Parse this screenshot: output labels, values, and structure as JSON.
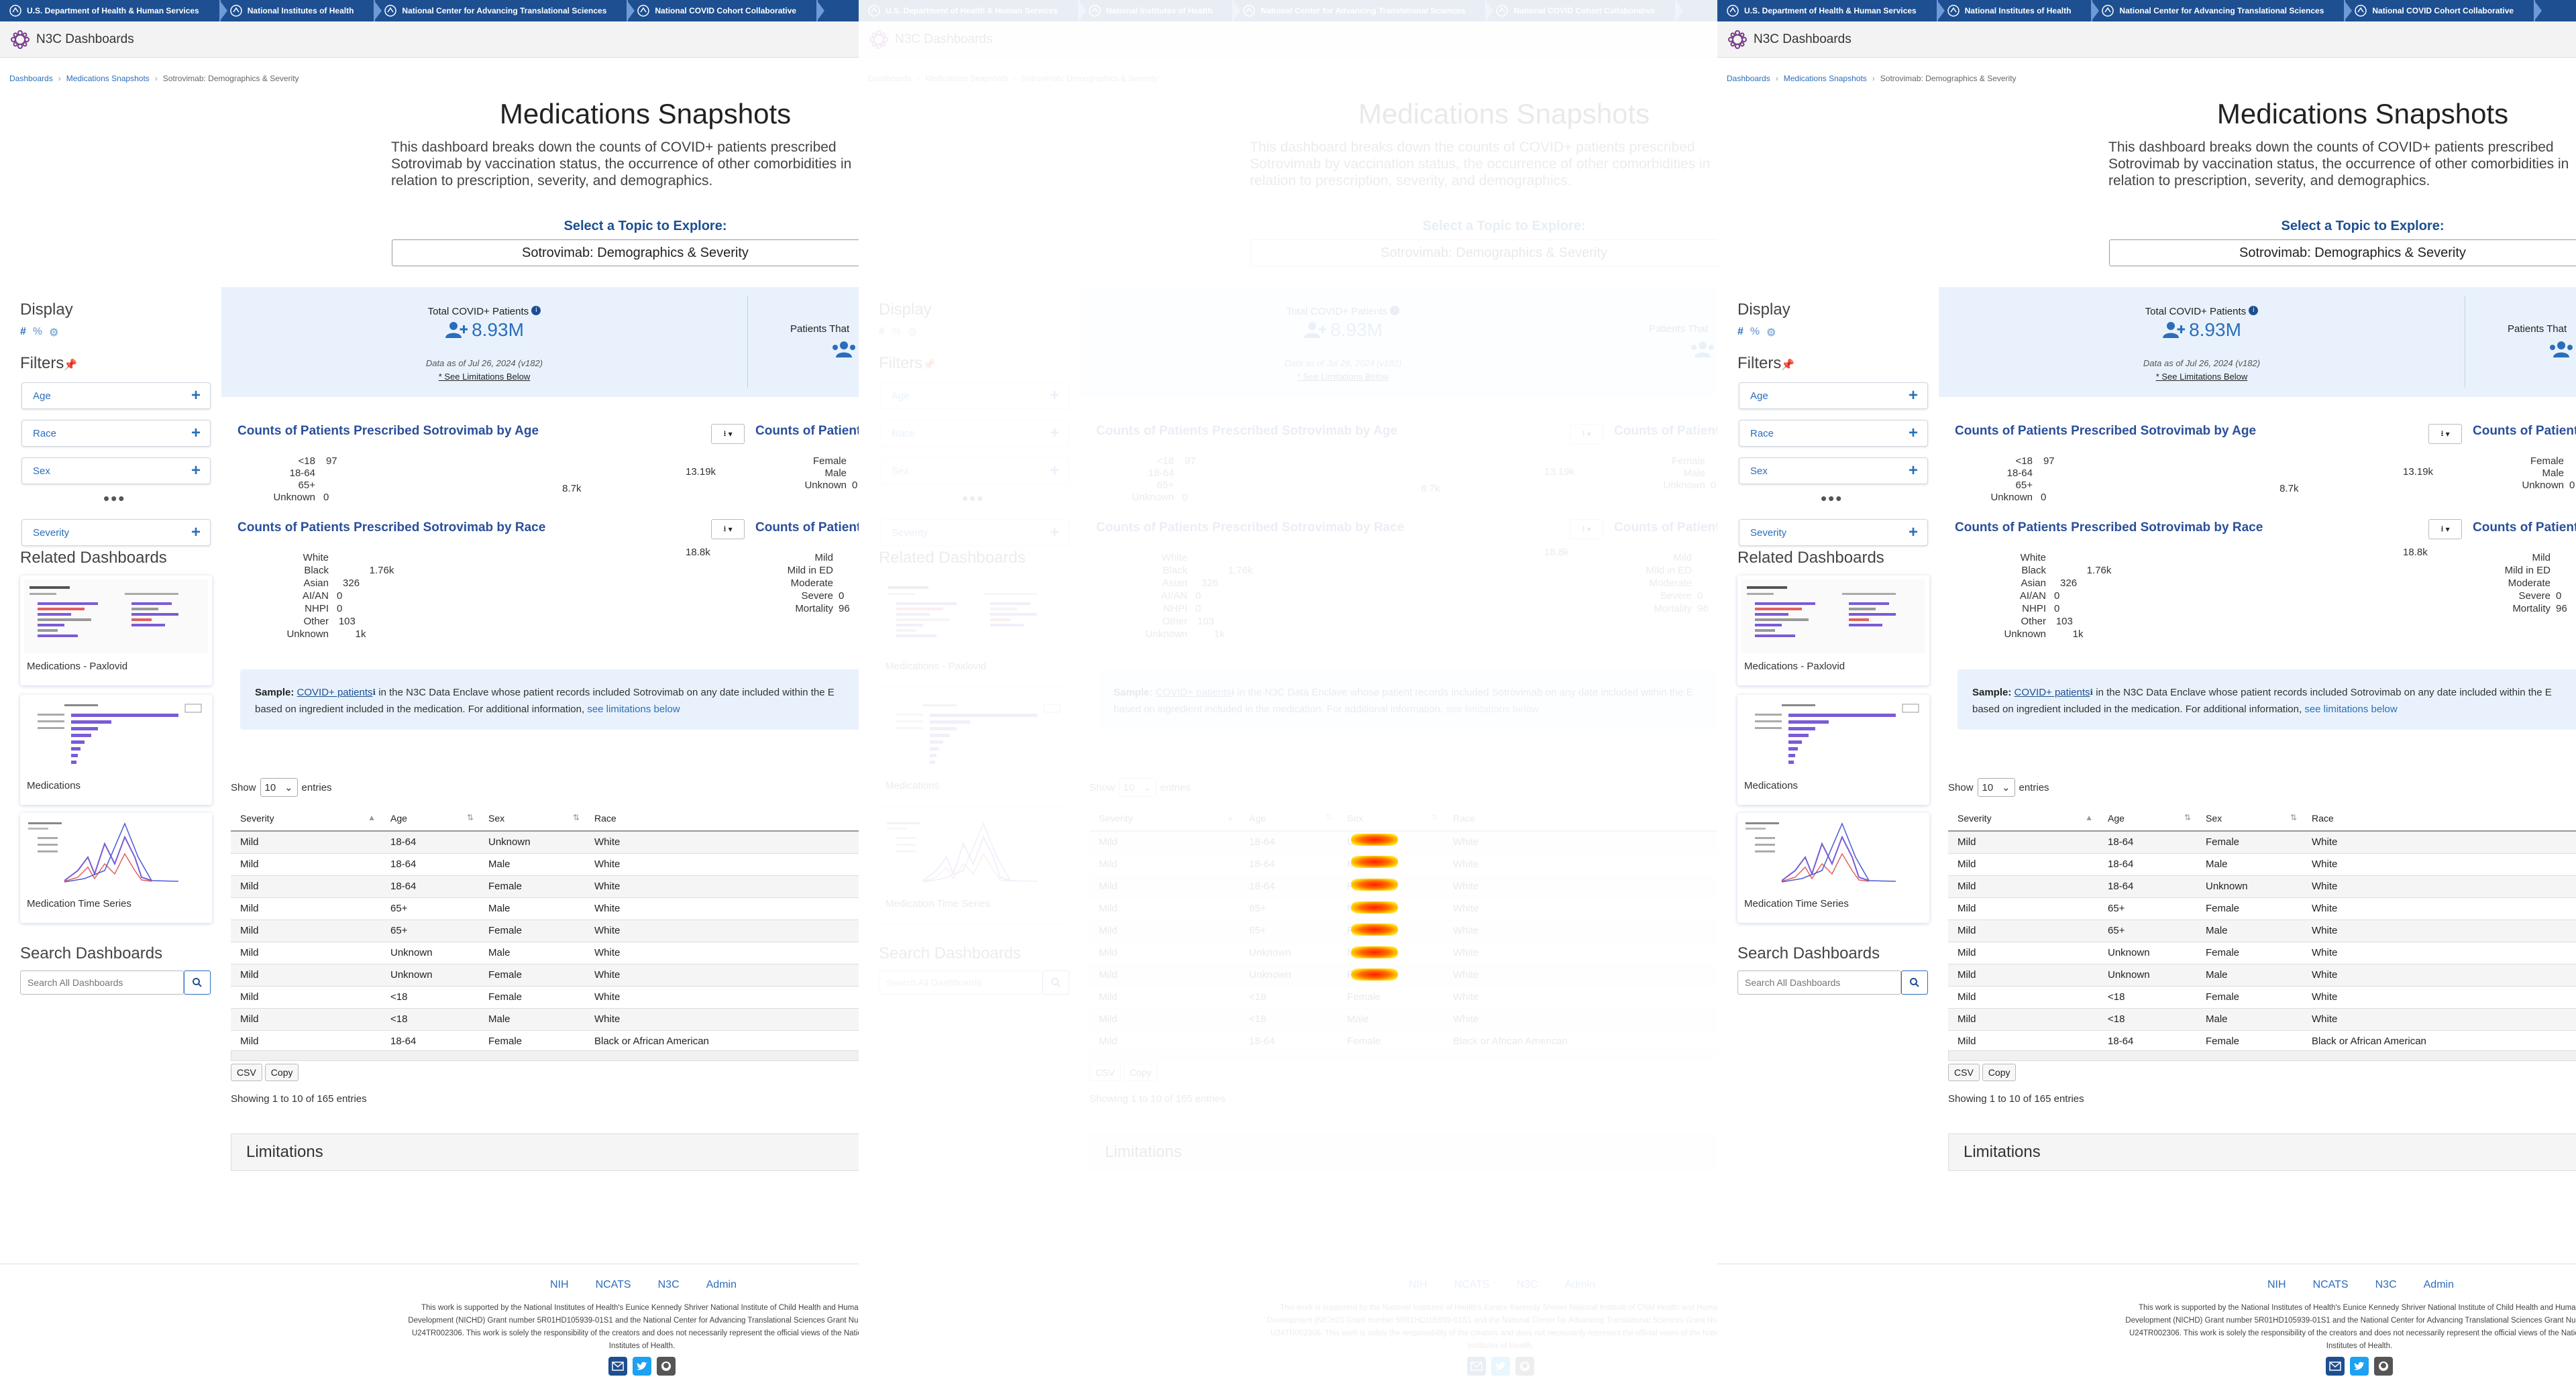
{
  "ribbon": [
    "U.S. Department of Health & Human Services",
    "National Institutes of Health",
    "National Center for Advancing Translational Sciences",
    "National COVID Cohort Collaborative"
  ],
  "app": {
    "title": "N3C Dashboards"
  },
  "breadcrumb": [
    "Dashboards",
    "Medications Snapshots",
    "Sotrovimab: Demographics & Severity"
  ],
  "page": {
    "title": "Medications Snapshots",
    "intro": "This dashboard breaks down the counts of COVID+ patients prescribed Sotrovimab by vaccination status, the occurrence of other comorbidities in relation to prescription, severity, and demographics.",
    "select_label": "Select a Topic to Explore:",
    "selected_topic": "Sotrovimab: Demographics & Severity"
  },
  "sidebar": {
    "display_heading": "Display",
    "display_icons": [
      "#",
      "%",
      "⚙"
    ],
    "filters_heading": "Filters",
    "filters": [
      "Age",
      "Race",
      "Sex",
      "Severity"
    ],
    "more": "•••",
    "related_heading": "Related Dashboards",
    "related": [
      "Medications - Paxlovid",
      "Medications",
      "Medication Time Series"
    ],
    "search_heading": "Search Dashboards",
    "search_placeholder": "Search All Dashboards"
  },
  "stats": {
    "total_title": "Total COVID+ Patients",
    "total_value": "8.93M",
    "as_of": "Data as of Jul 26, 2024 (v182)",
    "limitations_link": "* See Limitations Below",
    "second_title": "Patients That"
  },
  "charts": {
    "age": {
      "title": "Counts of Patients Prescribed Sotrovimab by Age",
      "right_title": "Counts of Patients"
    },
    "race": {
      "title": "Counts of Patients Prescribed Sotrovimab by Race",
      "right_title": "Counts of Patients"
    }
  },
  "chart_data": [
    {
      "type": "bar",
      "title": "Counts of Patients Prescribed Sotrovimab by Age",
      "categories": [
        "<18",
        "18-64",
        "65+",
        "Unknown"
      ],
      "values": [
        97,
        13190,
        8700,
        0
      ],
      "labels": [
        "97",
        "13.19k",
        "8.7k",
        "0"
      ],
      "max": 13190
    },
    {
      "type": "bar",
      "title": "Counts of Patients Prescribed Sotrovimab by Race",
      "categories": [
        "White",
        "Black",
        "Asian",
        "AI/AN",
        "NHPI",
        "Other",
        "Unknown"
      ],
      "values": [
        18800,
        1760,
        326,
        0,
        0,
        103,
        1000
      ],
      "labels": [
        "18.8k",
        "1.76k",
        "326",
        "0",
        "0",
        "103",
        "1k"
      ],
      "max": 18800
    },
    {
      "type": "bar",
      "title": "Counts of Patients",
      "categories": [
        "Female",
        "Male",
        "Unknown"
      ],
      "values": [
        null,
        null,
        0
      ],
      "labels": [
        "",
        "",
        "0"
      ]
    },
    {
      "type": "bar",
      "title": "Counts of Patients",
      "categories": [
        "Mild",
        "Mild in ED",
        "Moderate",
        "Severe",
        "Mortality"
      ],
      "values": [
        null,
        null,
        null,
        0,
        96
      ],
      "labels": [
        "",
        "",
        "",
        "0",
        "96"
      ]
    }
  ],
  "sample": {
    "label": "Sample:",
    "link": "COVID+ patients",
    "text1": " in the N3C Data Enclave whose patient records included Sotrovimab on any date included within the E",
    "text2": "based on ingredient included in the medication. For additional information, ",
    "more_link": "see limitations below"
  },
  "table": {
    "show": "Show",
    "entries_value": "10",
    "entries": "entries",
    "columns": [
      "Severity",
      "Age",
      "Sex",
      "Race"
    ],
    "rows_a": [
      [
        "Mild",
        "18-64",
        "Unknown",
        "White"
      ],
      [
        "Mild",
        "18-64",
        "Male",
        "White"
      ],
      [
        "Mild",
        "18-64",
        "Female",
        "White"
      ],
      [
        "Mild",
        "65+",
        "Male",
        "White"
      ],
      [
        "Mild",
        "65+",
        "Female",
        "White"
      ],
      [
        "Mild",
        "Unknown",
        "Male",
        "White"
      ],
      [
        "Mild",
        "Unknown",
        "Female",
        "White"
      ],
      [
        "Mild",
        "<18",
        "Female",
        "White"
      ],
      [
        "Mild",
        "<18",
        "Male",
        "White"
      ],
      [
        "Mild",
        "18-64",
        "Female",
        "Black or African American"
      ]
    ],
    "rows_b": [
      [
        "Mild",
        "18-64",
        "Female",
        "White"
      ],
      [
        "Mild",
        "18-64",
        "Male",
        "White"
      ],
      [
        "Mild",
        "18-64",
        "Unknown",
        "White"
      ],
      [
        "Mild",
        "65+",
        "Female",
        "White"
      ],
      [
        "Mild",
        "65+",
        "Male",
        "White"
      ],
      [
        "Mild",
        "Unknown",
        "Female",
        "White"
      ],
      [
        "Mild",
        "Unknown",
        "Male",
        "White"
      ],
      [
        "Mild",
        "<18",
        "Female",
        "White"
      ],
      [
        "Mild",
        "<18",
        "Male",
        "White"
      ],
      [
        "Mild",
        "18-64",
        "Female",
        "Black or African American"
      ]
    ],
    "buttons": [
      "CSV",
      "Copy"
    ],
    "showing": "Showing 1 to 10 of 165 entries"
  },
  "limitations": "Limitations",
  "footer": {
    "links": [
      "NIH",
      "NCATS",
      "N3C",
      "Admin"
    ],
    "text": "This work is supported by the National Institutes of Health's Eunice Kennedy Shriver National Institute of Child Health and Human Development (NICHD) Grant number 5R01HD105939-01S1 and the National Center for Advancing Translational Sciences Grant Number U24TR002306. This work is solely the responsibility of the creators and does not necessarily represent the official views of the National Institutes of Health."
  },
  "colors": {
    "ribbon": "#1d4f91",
    "link": "#2a6ebb",
    "bar": "#6c4fd8",
    "stat_bg": "#e9f2fc"
  }
}
